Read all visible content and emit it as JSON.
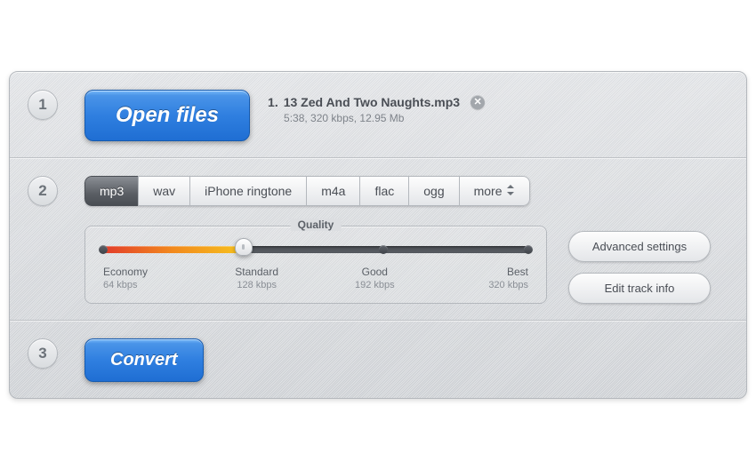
{
  "step1": {
    "number": "1",
    "open_button": "Open files",
    "file": {
      "index": "1.",
      "name": "13 Zed And Two Naughts.mp3",
      "meta": "5:38, 320 kbps, 12.95 Mb"
    }
  },
  "step2": {
    "number": "2",
    "formats": {
      "active": "mp3",
      "items": [
        "mp3",
        "wav",
        "iPhone ringtone",
        "m4a",
        "flac",
        "ogg",
        "more"
      ]
    },
    "quality": {
      "title": "Quality",
      "value_percent": 33,
      "levels": [
        {
          "label": "Economy",
          "kbps": "64 kbps",
          "pos": 0
        },
        {
          "label": "Standard",
          "kbps": "128 kbps",
          "pos": 33
        },
        {
          "label": "Good",
          "kbps": "192 kbps",
          "pos": 66
        },
        {
          "label": "Best",
          "kbps": "320 kbps",
          "pos": 100
        }
      ]
    },
    "advanced_button": "Advanced settings",
    "edit_track_button": "Edit track info"
  },
  "step3": {
    "number": "3",
    "convert_button": "Convert"
  }
}
